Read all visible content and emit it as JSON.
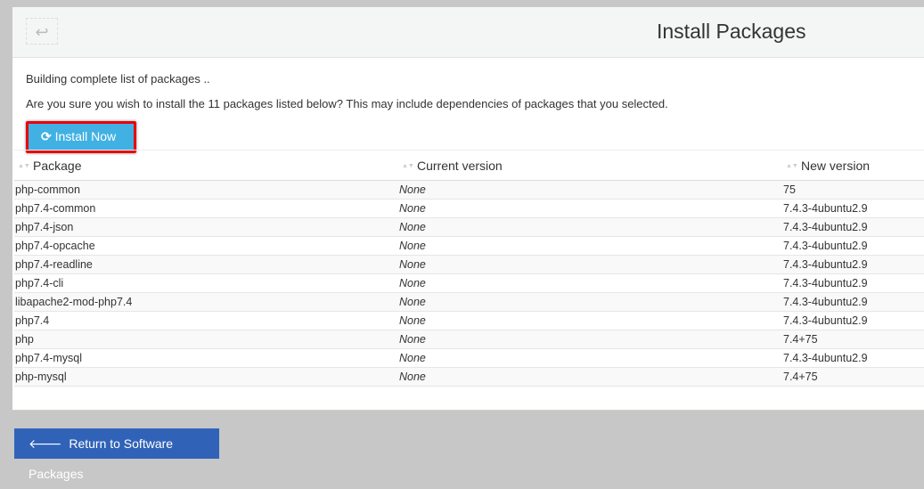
{
  "header": {
    "title": "Install Packages",
    "back_icon": "return-arrow-icon"
  },
  "status_text": "Building complete list of packages ..",
  "confirm_text": "Are you sure you wish to install the 11 packages listed below? This may include dependencies of packages that you selected.",
  "install_button": {
    "label": "Install Now",
    "icon": "refresh-icon"
  },
  "table": {
    "columns": [
      "Package",
      "Current version",
      "New version"
    ],
    "rows": [
      [
        "php-common",
        "None",
        "75"
      ],
      [
        "php7.4-common",
        "None",
        "7.4.3-4ubuntu2.9"
      ],
      [
        "php7.4-json",
        "None",
        "7.4.3-4ubuntu2.9"
      ],
      [
        "php7.4-opcache",
        "None",
        "7.4.3-4ubuntu2.9"
      ],
      [
        "php7.4-readline",
        "None",
        "7.4.3-4ubuntu2.9"
      ],
      [
        "php7.4-cli",
        "None",
        "7.4.3-4ubuntu2.9"
      ],
      [
        "libapache2-mod-php7.4",
        "None",
        "7.4.3-4ubuntu2.9"
      ],
      [
        "php7.4",
        "None",
        "7.4.3-4ubuntu2.9"
      ],
      [
        "php",
        "None",
        "7.4+75"
      ],
      [
        "php7.4-mysql",
        "None",
        "7.4.3-4ubuntu2.9"
      ],
      [
        "php-mysql",
        "None",
        "7.4+75"
      ]
    ]
  },
  "return_button": {
    "label": "Return to Software Packages",
    "icon": "arrow-left-icon"
  },
  "colors": {
    "install": "#41b1e4",
    "return": "#3063b8",
    "highlight": "#e8000d"
  }
}
